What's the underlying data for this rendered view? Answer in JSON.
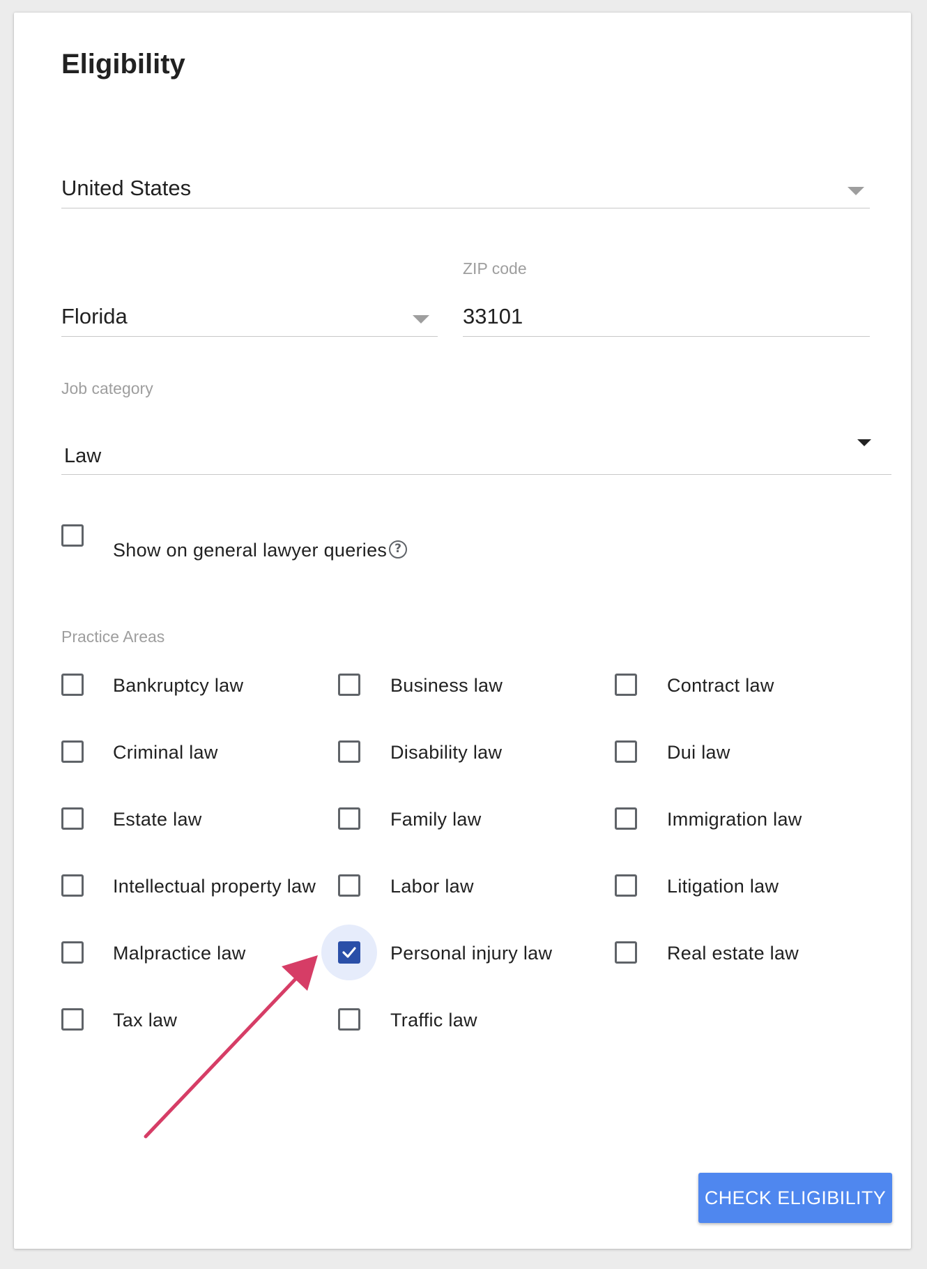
{
  "card": {
    "title": "Eligibility",
    "country": {
      "value": "United States"
    },
    "state": {
      "value": "Florida"
    },
    "zip": {
      "label": "ZIP code",
      "value": "33101"
    },
    "job_category": {
      "label": "Job category",
      "value": "Law"
    },
    "general_queries": {
      "label": "Show on general lawyer queries",
      "checked": false,
      "help_icon": "help-circle-icon"
    },
    "practice_areas": {
      "label": "Practice Areas",
      "items": [
        {
          "label": "Bankruptcy law",
          "checked": false
        },
        {
          "label": "Business law",
          "checked": false
        },
        {
          "label": "Contract law",
          "checked": false
        },
        {
          "label": "Criminal law",
          "checked": false
        },
        {
          "label": "Disability law",
          "checked": false
        },
        {
          "label": "Dui law",
          "checked": false
        },
        {
          "label": "Estate law",
          "checked": false
        },
        {
          "label": "Family law",
          "checked": false
        },
        {
          "label": "Immigration law",
          "checked": false
        },
        {
          "label": "Intellectual property law",
          "checked": false
        },
        {
          "label": "Labor law",
          "checked": false
        },
        {
          "label": "Litigation law",
          "checked": false
        },
        {
          "label": "Malpractice law",
          "checked": false
        },
        {
          "label": "Personal injury law",
          "checked": true
        },
        {
          "label": "Real estate law",
          "checked": false
        },
        {
          "label": "Tax law",
          "checked": false
        },
        {
          "label": "Traffic law",
          "checked": false
        }
      ]
    },
    "check_button": {
      "label": "CHECK ELIGIBILITY"
    }
  },
  "colors": {
    "accent": "#4f87ef",
    "checked": "#2a4fa8",
    "annotation_arrow": "#d63d66"
  }
}
